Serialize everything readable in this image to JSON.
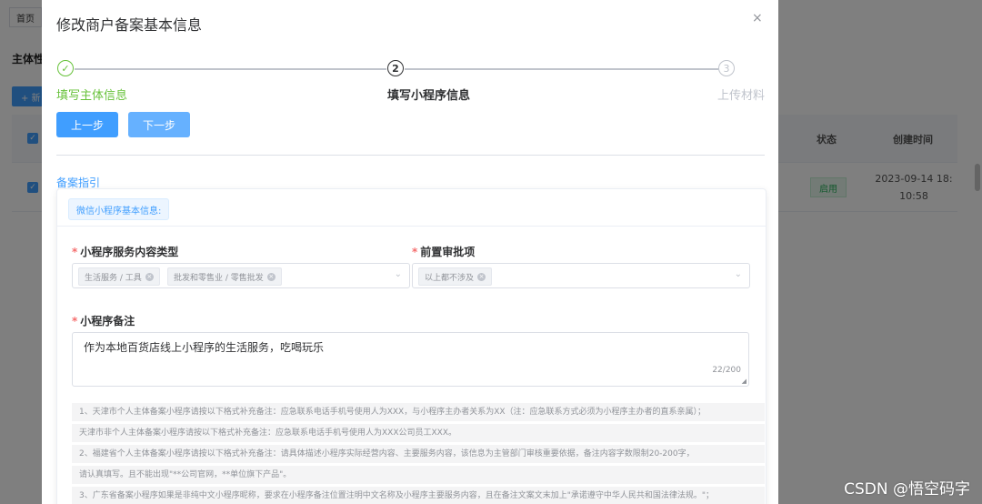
{
  "background": {
    "tab_label": "首页",
    "section_title": "主体性",
    "add_button": "+ 新",
    "table_headers": {
      "status": "状态",
      "created": "创建时间"
    },
    "row": {
      "status_badge": "启用",
      "created_line1": "2023-09-14 18:",
      "created_line2": "10:58"
    }
  },
  "dialog": {
    "title": "修改商户备案基本信息",
    "close_glyph": "×",
    "steps": [
      {
        "number": "✓",
        "label": "填写主体信息",
        "state": "success"
      },
      {
        "number": "2",
        "label": "填写小程序信息",
        "state": "process"
      },
      {
        "number": "3",
        "label": "上传材料",
        "state": "wait"
      }
    ],
    "prev_button": "上一步",
    "next_button": "下一步",
    "guide_link": "备案指引",
    "card": {
      "tag": "微信小程序基本信息:",
      "service_type": {
        "label": "小程序服务内容类型",
        "required": "*",
        "tags": [
          "生活服务 / 工具",
          "批发和零售业 / 零售批发"
        ]
      },
      "pre_approval": {
        "label": "前置审批项",
        "required": "*",
        "tags": [
          "以上都不涉及"
        ]
      },
      "remark": {
        "label": "小程序备注",
        "required": "*",
        "value": "作为本地百货店线上小程序的生活服务，吃喝玩乐",
        "counter": "22/200"
      },
      "notes": [
        "1、天津市个人主体备案小程序请按以下格式补充备注：应急联系电话手机号使用人为XXX，与小程序主办者关系为XX（注：应急联系方式必须为小程序主办者的直系亲属）；",
        "天津市非个人主体备案小程序请按以下格式补充备注：应急联系电话手机号使用人为XXX公司员工XXX。",
        "2、福建省个人主体备案小程序请按以下格式补充备注：请具体描述小程序实际经营内容、主要服务内容，该信息为主管部门审核重要依据，备注内容字数限制20-200字，",
        "请认真填写。且不能出现\"**公司官网，**单位旗下产品\"。",
        "3、广东省备案小程序如果是非纯中文小程序昵称，要求在小程序备注位置注明中文名称及小程序主要服务内容，且在备注文案文末加上\"承诺遵守中华人民共和国法律法规。\"；"
      ]
    }
  },
  "watermark": "CSDN @悟空码字"
}
